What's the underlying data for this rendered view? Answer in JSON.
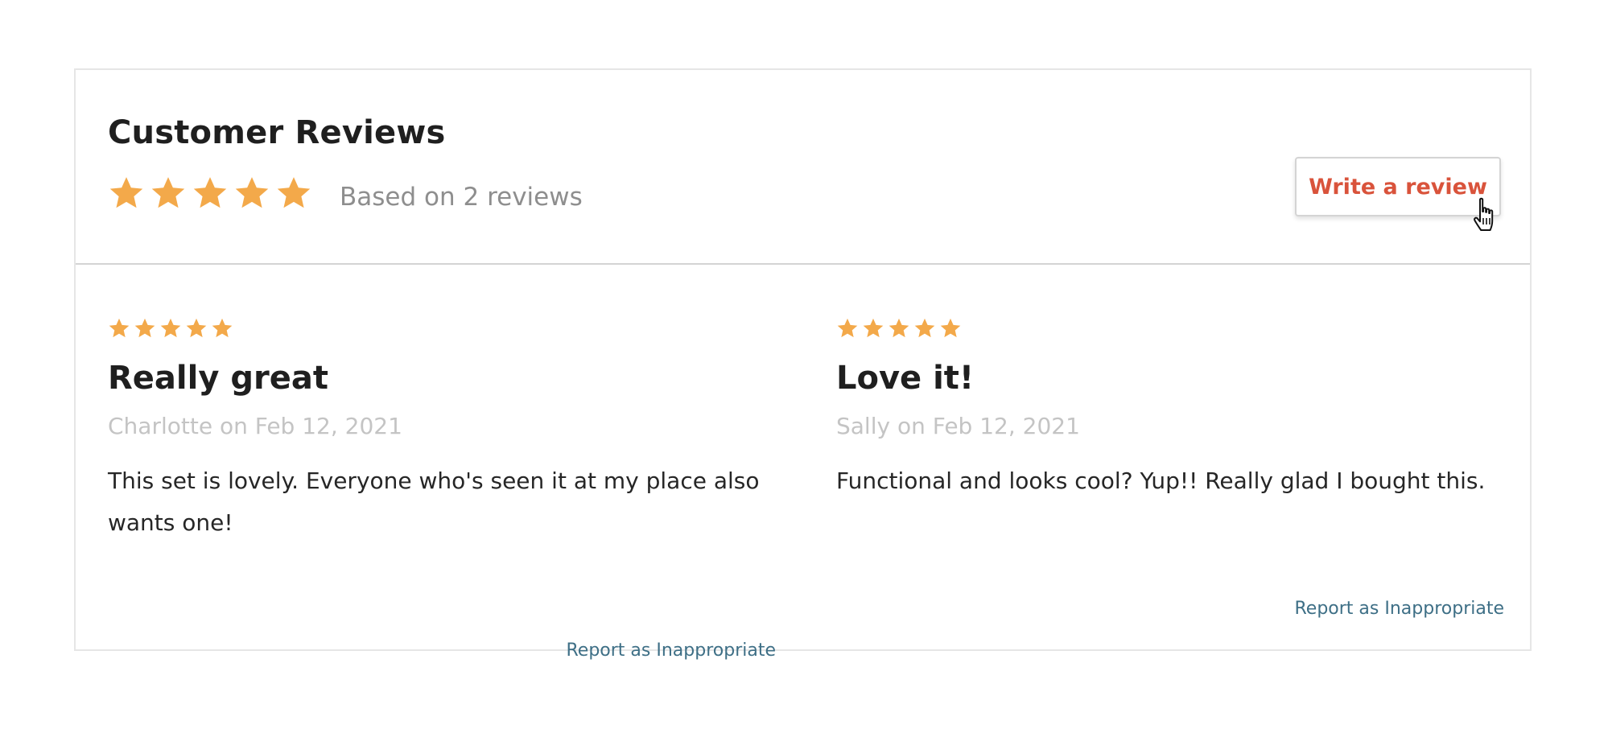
{
  "reviews_widget": {
    "title": "Customer Reviews",
    "average_rating": 5,
    "max_rating": 5,
    "summary_text": "Based on 2 reviews",
    "write_review_label": "Write a review",
    "star_color": "#f3a94a",
    "accent_color": "#d9533b",
    "link_color": "#3e6f86"
  },
  "reviews": [
    {
      "rating": 5,
      "title": "Really great",
      "meta": "Charlotte on Feb 12, 2021",
      "body": "This set is lovely. Everyone who's seen it at my place also wants one!",
      "report_label": "Report as Inappropriate"
    },
    {
      "rating": 5,
      "title": "Love it!",
      "meta": "Sally on Feb 12, 2021",
      "body": "Functional and looks cool? Yup!! Really glad I bought this.",
      "report_label": "Report as Inappropriate"
    }
  ],
  "icons": {
    "star": "star-icon",
    "cursor": "hand-pointer-cursor-icon"
  }
}
